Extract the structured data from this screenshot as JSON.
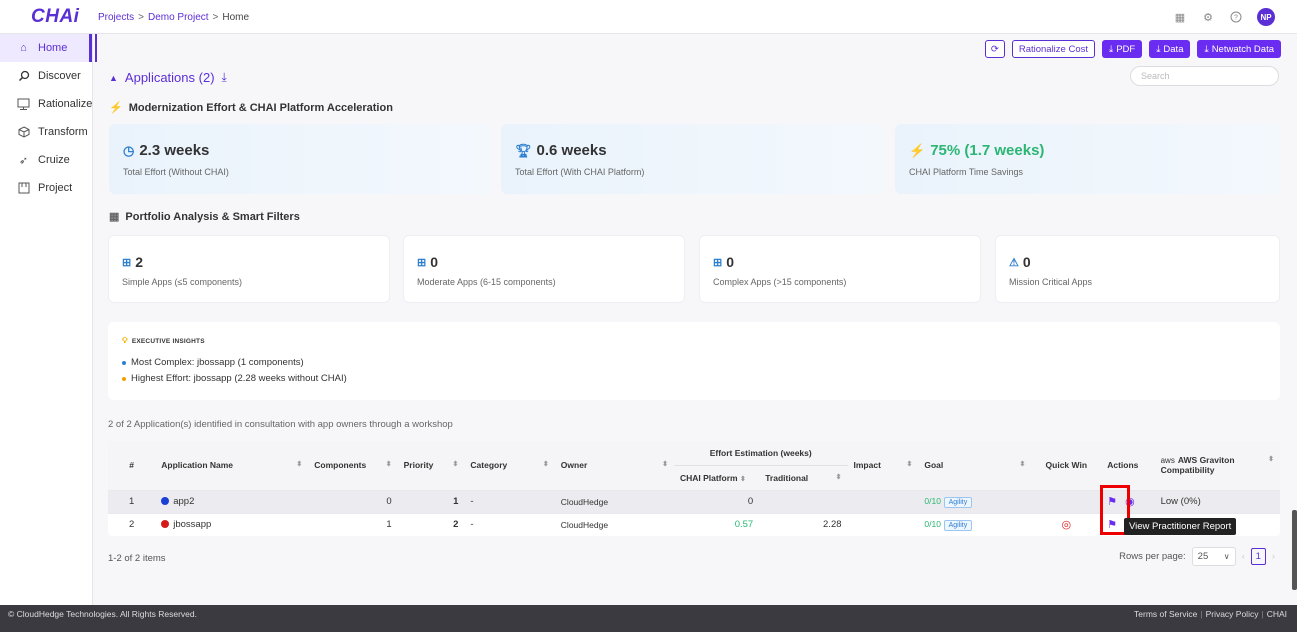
{
  "app": {
    "logo": "CHAi",
    "avatar": "NP"
  },
  "breadcrumb": {
    "items": [
      "Projects",
      "Demo Project",
      "Home"
    ],
    "sep": ">"
  },
  "sidebar": {
    "items": [
      {
        "label": "Home",
        "icon": "home-icon"
      },
      {
        "label": "Discover",
        "icon": "search-icon"
      },
      {
        "label": "Rationalize",
        "icon": "rationalize-icon"
      },
      {
        "label": "Transform",
        "icon": "cube-icon"
      },
      {
        "label": "Cruize",
        "icon": "rocket-icon"
      },
      {
        "label": "Project",
        "icon": "project-icon"
      }
    ]
  },
  "toolbar": {
    "rationalize": "Rationalize Cost",
    "pdf": "PDF",
    "data": "Data",
    "netwatch": "Netwatch Data"
  },
  "applications": {
    "title": "Applications (2)",
    "search_placeholder": "Search"
  },
  "effort": {
    "title": "Modernization Effort & CHAI Platform Acceleration",
    "cards": [
      {
        "value": "2.3 weeks",
        "label": "Total Effort (Without CHAI)"
      },
      {
        "value": "0.6 weeks",
        "label": "Total Effort (With CHAI Platform)"
      },
      {
        "value": "75% (1.7 weeks)",
        "label": "CHAI Platform Time Savings"
      }
    ]
  },
  "portfolio": {
    "title": "Portfolio Analysis & Smart Filters",
    "cards": [
      {
        "value": "2",
        "label": "Simple Apps (≤5 components)"
      },
      {
        "value": "0",
        "label": "Moderate Apps (6-15 components)"
      },
      {
        "value": "0",
        "label": "Complex Apps (>15 components)"
      },
      {
        "value": "0",
        "label": "Mission Critical Apps"
      }
    ]
  },
  "insights": {
    "title": "EXECUTIVE INSIGHTS",
    "items": [
      "Most Complex: jbossapp (1 components)",
      "Highest Effort: jbossapp (2.28 weeks without CHAI)"
    ]
  },
  "table": {
    "caption": "2 of 2 Application(s) identified in consultation with app owners through a workshop",
    "headers": {
      "num": "#",
      "name": "Application Name",
      "components": "Components",
      "priority": "Priority",
      "category": "Category",
      "owner": "Owner",
      "effort": "Effort Estimation (weeks)",
      "chai": "CHAI Platform",
      "traditional": "Traditional",
      "impact": "Impact",
      "goal": "Goal",
      "quickwin": "Quick Win",
      "actions": "Actions",
      "aws": "AWS Graviton Compatibility",
      "aws_logo": "aws"
    },
    "rows": [
      {
        "num": "1",
        "name": "app2",
        "color": "#1a3fd6",
        "components": "0",
        "priority": "1",
        "category": "-",
        "owner": "CloudHedge",
        "chai": "0",
        "traditional": "",
        "impact": "",
        "goal_score": "0/10",
        "goal": "Agility",
        "aws": "Low (0%)"
      },
      {
        "num": "2",
        "name": "jbossapp",
        "color": "#d61a1a",
        "components": "1",
        "priority": "2",
        "category": "-",
        "owner": "CloudHedge",
        "chai": "0.57",
        "traditional": "2.28",
        "impact": "",
        "goal_score": "0/10",
        "goal": "Agility",
        "aws": ""
      }
    ],
    "tooltip": "View Practitioner Report"
  },
  "pagination": {
    "summary": "1-2 of 2 items",
    "rows_label": "Rows per page:",
    "rows_value": "25",
    "page": "1"
  },
  "footer": {
    "copyright": "© CloudHedge Technologies. All Rights Reserved.",
    "links": [
      "Terms of Service",
      "Privacy Policy",
      "CHAI"
    ]
  },
  "colors": {
    "accent": "#5b2fd6",
    "button": "#6a2cf0",
    "green": "#2bb673",
    "highlight": "#e00000"
  }
}
